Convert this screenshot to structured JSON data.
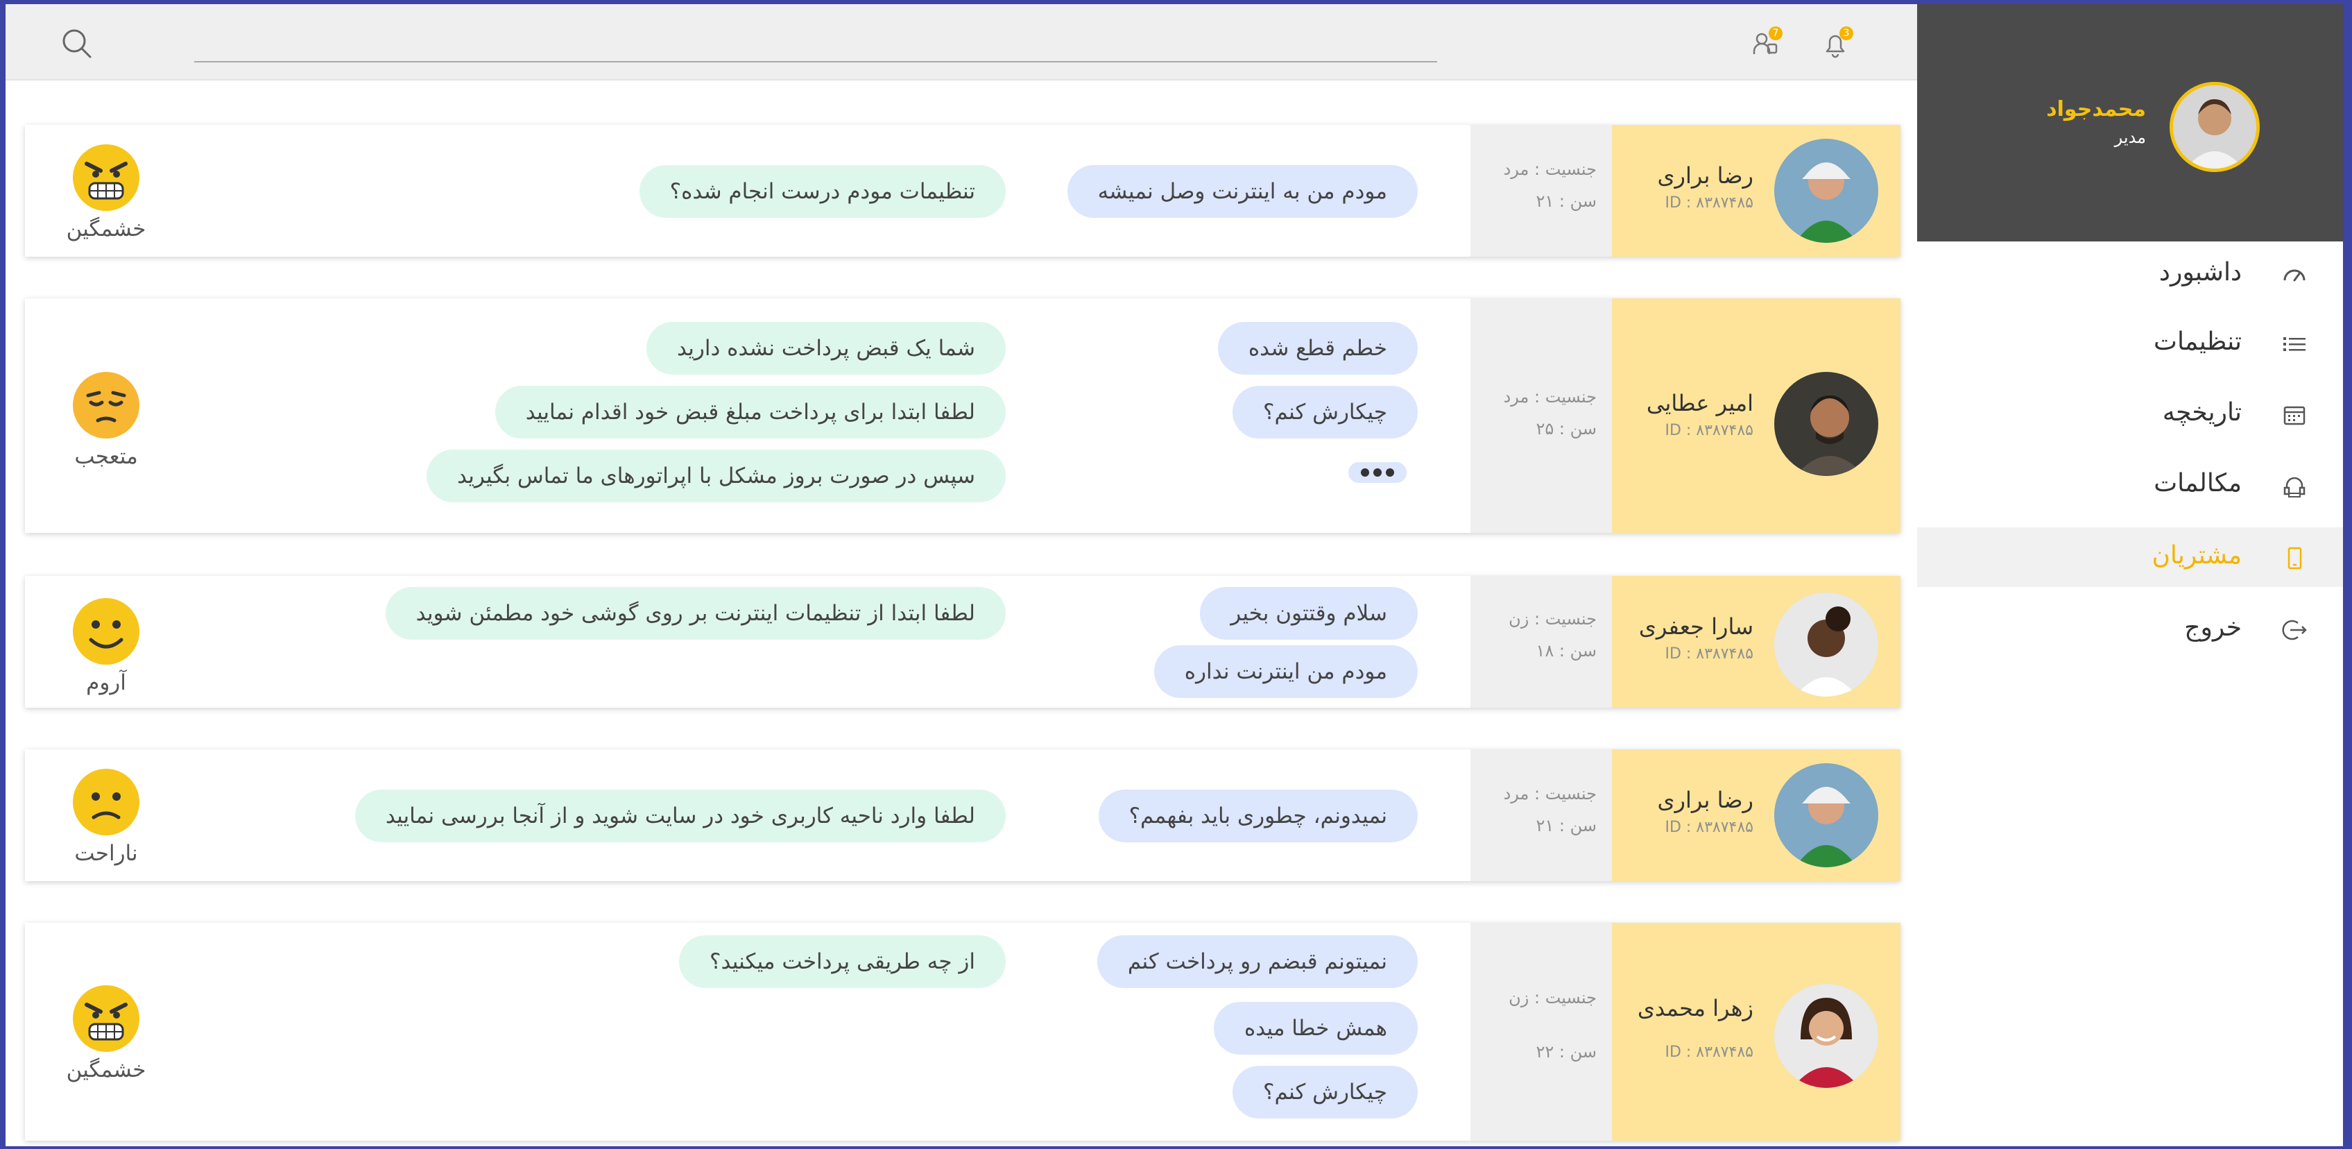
{
  "colors": {
    "accent": "#f4b400",
    "sidebar_header_bg": "#4b4b4b",
    "user_panel_bg": "#fde49a",
    "customer_bubble_bg": "#dce6fd",
    "agent_bubble_bg": "#def7ec",
    "page_border": "#3d44a3"
  },
  "topbar": {
    "search_icon": "search-icon",
    "notifications_badge": "3",
    "requests_badge": "7"
  },
  "sidebar": {
    "profile": {
      "name": "محمدجواد",
      "role": "مدیر"
    },
    "items": [
      {
        "label": "داشبورد",
        "icon": "speedometer-icon"
      },
      {
        "label": "تنظیمات",
        "icon": "list-icon"
      },
      {
        "label": "تاریخچه",
        "icon": "calendar-icon"
      },
      {
        "label": "مکالمات",
        "icon": "headset-icon"
      },
      {
        "label": "مشتریان",
        "icon": "phone-icon",
        "active": true
      },
      {
        "label": "خروج",
        "icon": "logout-icon"
      }
    ]
  },
  "cards": [
    {
      "name": "رضا براری",
      "id": "ID : ۸۳۸۷۴۸۵",
      "gender": "جنسیت : مرد",
      "age": "سن : ۲۱",
      "customer_messages": [
        "مودم من به اینترنت وصل نمیشه"
      ],
      "agent_messages": [
        "تنظیمات مودم درست انجام شده؟"
      ],
      "emotion": "خشمگین"
    },
    {
      "name": "امیر عطایی",
      "id": "ID : ۸۳۸۷۴۸۵",
      "gender": "جنسیت : مرد",
      "age": "سن : ۲۵",
      "customer_messages": [
        "خطم قطع شده",
        "چیکارش کنم؟"
      ],
      "agent_messages": [
        "شما یک قبض پرداخت نشده دارید",
        "لطفا ابتدا برای پرداخت مبلغ قبض خود اقدام نمایید",
        "سپس در صورت بروز مشکل با اپراتورهای ما تماس بگیرید"
      ],
      "emotion": "متعجب"
    },
    {
      "name": "سارا جعفری",
      "id": "ID : ۸۳۸۷۴۸۵",
      "gender": "جنسیت : زن",
      "age": "سن : ۱۸",
      "customer_messages": [
        "سلام وقتتون بخیر",
        "مودم من اینترنت نداره"
      ],
      "agent_messages": [
        "لطفا ابتدا از تنظیمات اینترنت بر روی گوشی خود مطمئن شوید"
      ],
      "emotion": "آروم"
    },
    {
      "name": "رضا براری",
      "id": "ID : ۸۳۸۷۴۸۵",
      "gender": "جنسیت : مرد",
      "age": "سن : ۲۱",
      "customer_messages": [
        "نمیدونم، چطوری باید بفهمم؟"
      ],
      "agent_messages": [
        "لطفا وارد ناحیه کاربری خود در سایت شوید و از آنجا بررسی نمایید"
      ],
      "emotion": "ناراحت"
    },
    {
      "name": "زهرا محمدی",
      "id": "ID : ۸۳۸۷۴۸۵",
      "gender": "جنسیت : زن",
      "age": "سن : ۲۲",
      "customer_messages": [
        "نمیتونم قبضم رو پرداخت کنم",
        "همش خطا میده",
        "چیکارش کنم؟"
      ],
      "agent_messages": [
        "از چه طریقی پرداخت میکنید؟"
      ],
      "emotion": "خشمگین"
    }
  ]
}
